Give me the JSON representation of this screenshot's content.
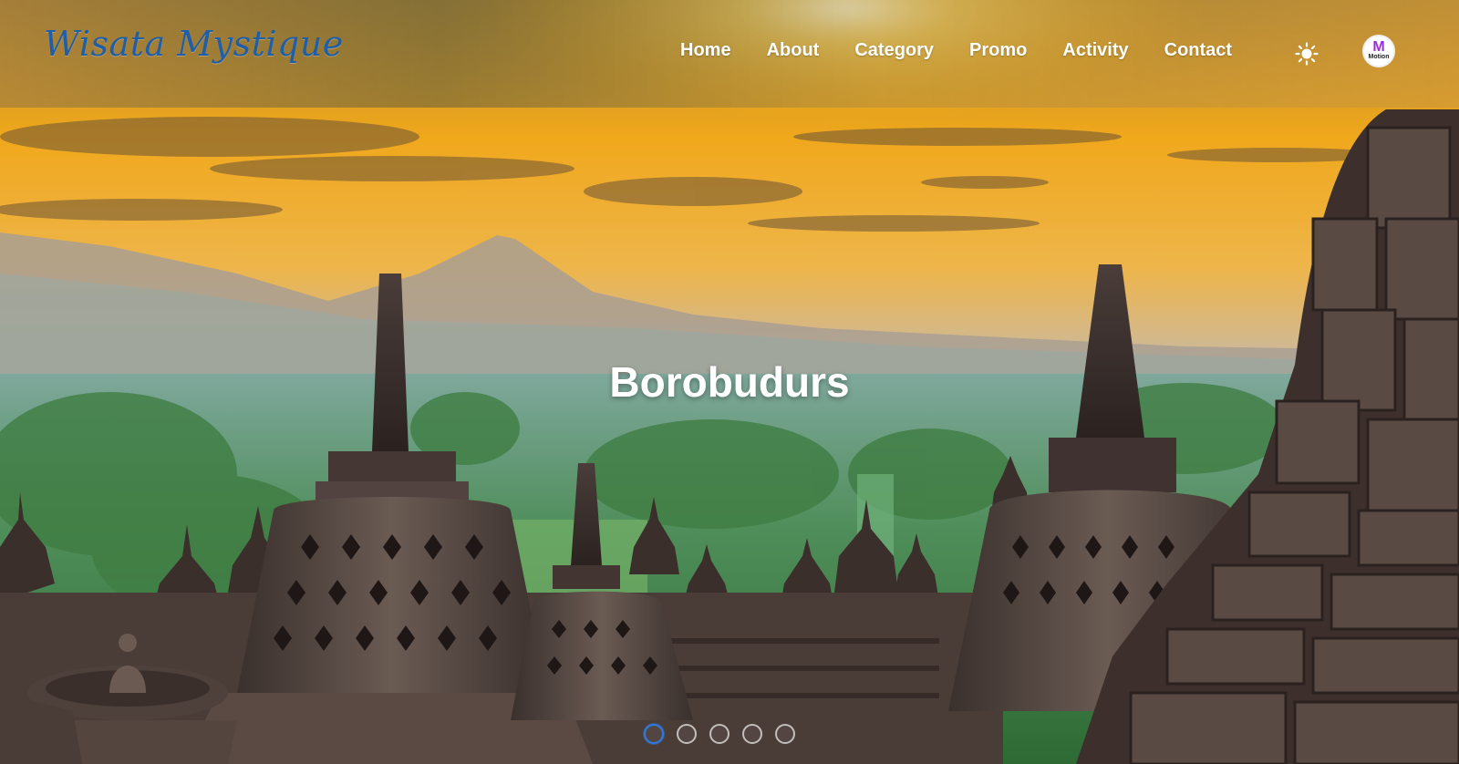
{
  "brand": {
    "name": "Wisata Mystique"
  },
  "nav": {
    "links": [
      {
        "label": "Home"
      },
      {
        "label": "About"
      },
      {
        "label": "Category"
      },
      {
        "label": "Promo"
      },
      {
        "label": "Activity"
      },
      {
        "label": "Contact"
      }
    ],
    "theme_icon": "sun-icon",
    "profile": {
      "logo_letter": "M",
      "logo_text": "Motion"
    }
  },
  "hero": {
    "title": "Borobudurs",
    "image": "borobudur-sunrise-photo",
    "slides_total": 5,
    "active_slide": 1
  },
  "colors": {
    "brand": "#1f5ea8",
    "nav_text": "#ffffff",
    "active_dot": "#2f7be0"
  }
}
